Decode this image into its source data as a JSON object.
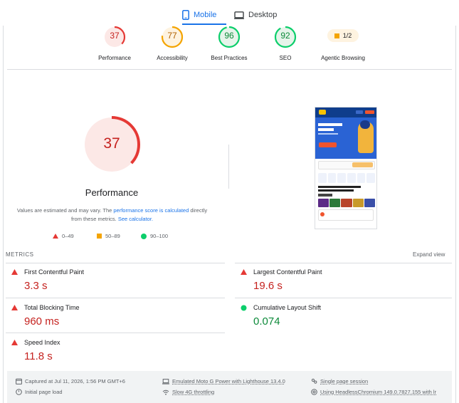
{
  "tabs": [
    {
      "label": "Mobile",
      "active": true
    },
    {
      "label": "Desktop",
      "active": false
    }
  ],
  "categories": [
    {
      "score": "37",
      "label": "Performance",
      "color": "#e53935"
    },
    {
      "score": "77",
      "label": "Accessibility",
      "color": "#f4a400"
    },
    {
      "score": "96",
      "label": "Best Practices",
      "color": "#0cce6b"
    },
    {
      "score": "92",
      "label": "SEO",
      "color": "#0cce6b"
    },
    {
      "score": "1/2",
      "label": "Agentic Browsing",
      "color": "#f4a400"
    }
  ],
  "main": {
    "score": "37",
    "score_fraction": 0.37,
    "title": "Performance",
    "disclaimer_pre": "Values are estimated and may vary. The ",
    "disclaimer_link1": "performance score is calculated",
    "disclaimer_mid": " directly from these metrics. ",
    "disclaimer_link2": "See calculator.",
    "legend": [
      "0–49",
      "50–89",
      "90–100"
    ]
  },
  "metrics": {
    "heading": "METRICS",
    "expand": "Expand view",
    "items": [
      {
        "name": "First Contentful Paint",
        "value": "3.3 s",
        "status": "fail"
      },
      {
        "name": "Largest Contentful Paint",
        "value": "19.6 s",
        "status": "fail"
      },
      {
        "name": "Total Blocking Time",
        "value": "960 ms",
        "status": "fail"
      },
      {
        "name": "Cumulative Layout Shift",
        "value": "0.074",
        "status": "pass"
      },
      {
        "name": "Speed Index",
        "value": "11.8 s",
        "status": "fail"
      }
    ]
  },
  "info": {
    "captured": "Captured at Jul 11, 2026, 1:56 PM GMT+6",
    "initial": "Initial page load",
    "device": "Emulated Moto G Power with Lighthouse 13.4.0",
    "throttle": "Slow 4G throttling",
    "session": "Single page session",
    "browser": "Using HeadlessChromium 149.0.7827.155 with lr"
  },
  "colors": {
    "accent": "#1a73e8",
    "fail": "#e53935",
    "average": "#f4a400",
    "pass": "#0cce6b"
  }
}
